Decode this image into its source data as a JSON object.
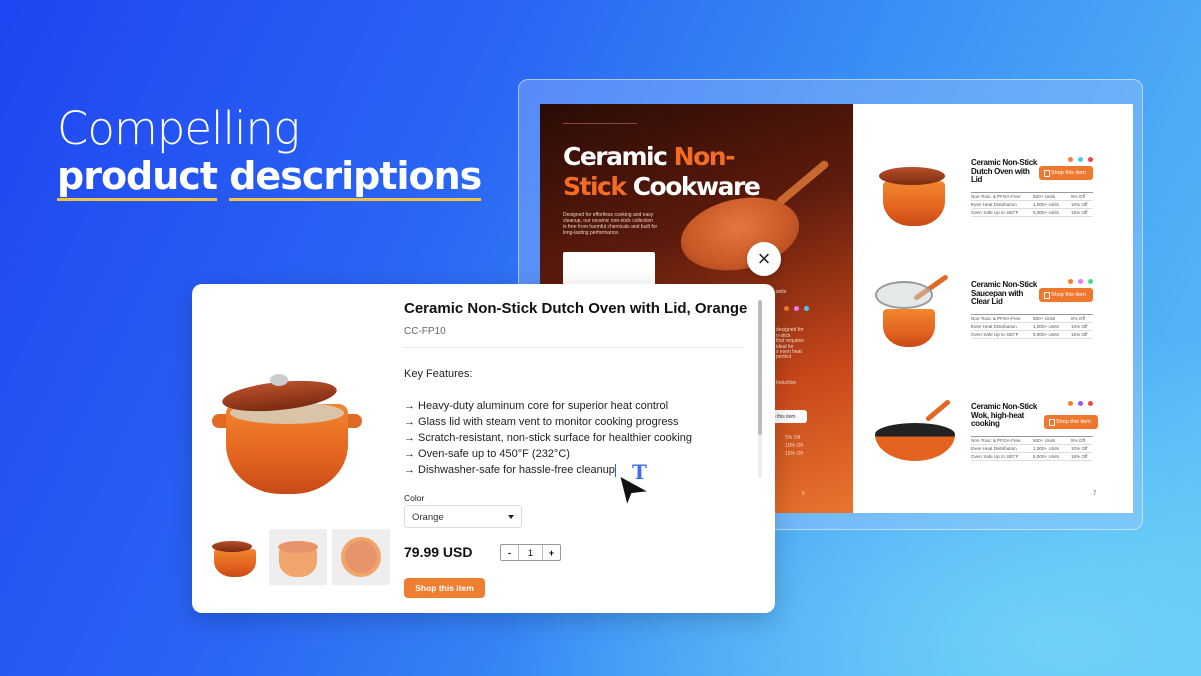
{
  "headline": {
    "line1": "Compelling",
    "word1": "product",
    "word2": "descriptions"
  },
  "brochure": {
    "left": {
      "title_white1": "Ceramic",
      "title_orange1": "Non-",
      "title_orange2": "Stick",
      "title_white2": "Cookware",
      "description": "Designed for effortless cooking and easy cleanup, our ceramic non-stick collection is free from harmful chemicals and built for long-lasting performance.",
      "fragments": [
        "500 units",
        "designed for",
        "n-stick",
        "that requires",
        "ideal for",
        "s even heat",
        "perfect",
        "Induction"
      ],
      "shop_label": "op this item",
      "discounts": [
        "5% Off",
        "10% Off",
        "15% Off"
      ],
      "page_number": "6"
    },
    "right": {
      "page_number": "7",
      "items": [
        {
          "title": "Ceramic Non-Stick Dutch Oven with Lid",
          "shop_label": "Shop this item",
          "dots": [
            "#f07e31",
            "#4cc9f0",
            "#ef4444"
          ],
          "rows": [
            [
              "Non-Toxic & PFOA-Free",
              "500+ Units",
              "5% Off"
            ],
            [
              "Even Heat Distribution",
              "1,000+ Units",
              "10% Off"
            ],
            [
              "Oven Safe Up to 400°F",
              "5,000+ Units",
              "15% Off"
            ]
          ]
        },
        {
          "title": "Ceramic Non-Stick Saucepan with Clear Lid",
          "shop_label": "Shop this item",
          "dots": [
            "#f07e31",
            "#e879f9",
            "#4ade80"
          ],
          "rows": [
            [
              "Non-Toxic & PFOA-Free",
              "500+ Units",
              "5% Off"
            ],
            [
              "Even Heat Distribution",
              "1,000+ Units",
              "10% Off"
            ],
            [
              "Oven Safe Up to 400°F",
              "5,000+ Units",
              "15% Off"
            ]
          ]
        },
        {
          "title": "Ceramic Non-Stick Wok, high-heat cooking",
          "shop_label": "Shop this item",
          "dots": [
            "#f07e31",
            "#8b5cf6",
            "#ef4444"
          ],
          "rows": [
            [
              "Non-Toxic & PFOA-Free",
              "500+ Units",
              "5% Off"
            ],
            [
              "Even Heat Distribution",
              "1,000+ Units",
              "10% Off"
            ],
            [
              "Oven Safe Up to 400°F",
              "5,000+ Units",
              "15% Off"
            ]
          ]
        }
      ]
    }
  },
  "close_icon": "×",
  "product": {
    "title": "Ceramic Non-Stick Dutch Oven with Lid, Orange",
    "sku": "CC-FP10",
    "features_heading": "Key Features:",
    "features": [
      "→ Heavy-duty aluminum core for superior heat control",
      "→ Glass lid with steam vent to monitor cooking progress",
      "→ Scratch-resistant, non-stick surface for healthier cooking",
      "→ Oven-safe up to 450°F (232°C)",
      "→ Dishwasher-safe for hassle-free cleanup"
    ],
    "color_label": "Color",
    "color_value": "Orange",
    "price": "79.99 USD",
    "quantity": "1",
    "qty_minus": "-",
    "qty_plus": "+",
    "shop_label": "Shop this item"
  },
  "text_cursor_icon": "T",
  "colors": {
    "accent": "#f07e31",
    "brand_blue": "#1f45f2",
    "underline": "#f5c242"
  }
}
